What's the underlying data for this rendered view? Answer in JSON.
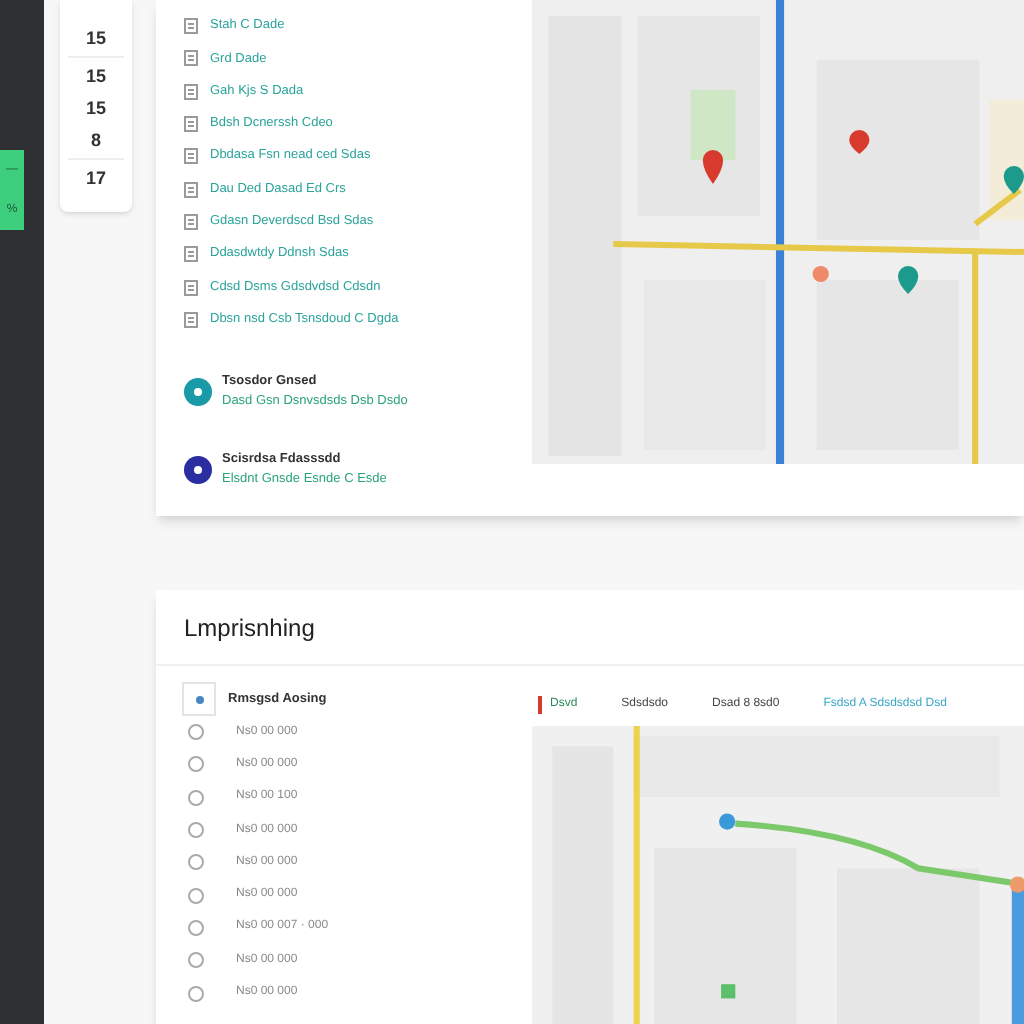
{
  "rail": {
    "tab_marks": [
      "—",
      "%"
    ]
  },
  "mini_sidebar": {
    "groups": [
      [
        "15"
      ],
      [
        "15",
        "15",
        "8"
      ],
      [
        "17"
      ]
    ]
  },
  "places": {
    "items": [
      {
        "label": "Stah C Dade"
      },
      {
        "label": "Grd Dade"
      },
      {
        "label": "Gah Kjs S Dada"
      },
      {
        "label": "Bdsh Dcnerssh Cdeo"
      },
      {
        "label": "Dbdasa Fsn nead ced Sdas"
      },
      {
        "label": "Dau Ded Dasad Ed Crs"
      },
      {
        "label": "Gdasn Deverdscd Bsd Sdas"
      },
      {
        "label": "Ddasdwtdy Ddnsh Sdas"
      },
      {
        "label": "Cdsd Dsms Gdsdvdsd Cdsdn"
      },
      {
        "label": "Dbsn nsd Csb Tsnsdoud C Dgda"
      }
    ],
    "highlights": [
      {
        "title": "Tsosdor Gnsed",
        "subtitle": "Dasd Gsn Dsnvsdsds Dsb Dsdo",
        "color": "#1a9aa6"
      },
      {
        "title": "Scisrdsa Fdasssdd",
        "subtitle": "Elsdnt Gnsde Esnde C Esde",
        "color": "#2a2ea0"
      }
    ]
  },
  "planning": {
    "title": "Lmprisnhing",
    "list_header": "Rmsgsd Aosing",
    "rows": [
      "Ns0 00 000",
      "Ns0 00 000",
      "Ns0 00 100",
      "Ns0 00 000",
      "Ns0 00 000",
      "Ns0 00 000",
      "Ns0 00 007 · 000",
      "Ns0 00 000",
      "Ns0 00 000"
    ],
    "map_toolbar": [
      {
        "label": "Dsvd",
        "kind": "marker"
      },
      {
        "label": "Sdsdsdo",
        "kind": "plain"
      },
      {
        "label": "Dsad 8 8sd0",
        "kind": "plain"
      },
      {
        "label": "Fsdsd A Sdsdsdsd Dsd",
        "kind": "link"
      }
    ]
  }
}
